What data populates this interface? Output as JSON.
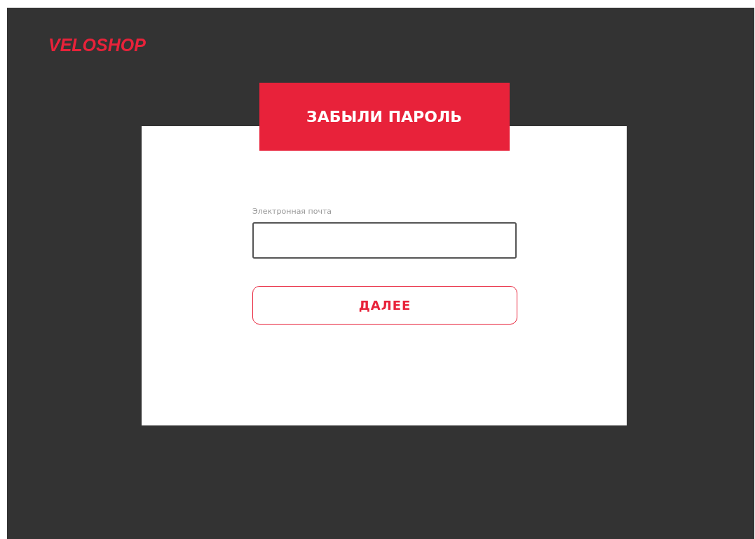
{
  "logo": "VELOSHOP",
  "card": {
    "title": "ЗАБЫЛИ ПАРОЛЬ",
    "field": {
      "label": "Электронная почта"
    },
    "button": "ДАЛЕЕ"
  }
}
